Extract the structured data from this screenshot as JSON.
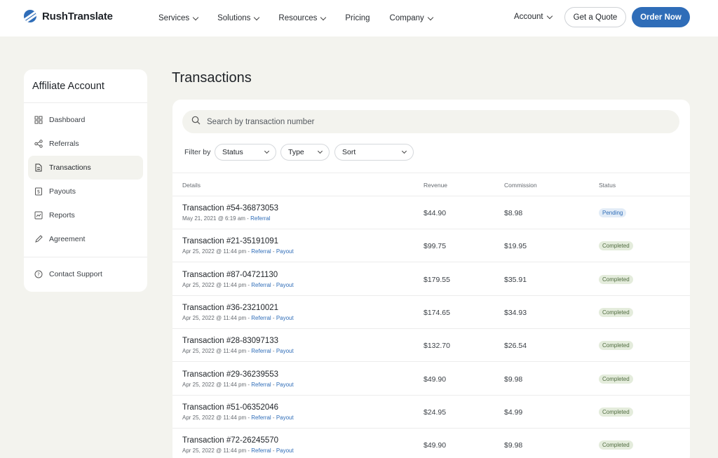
{
  "brand": {
    "name": "RushTranslate"
  },
  "nav": {
    "items": [
      {
        "label": "Services",
        "has_dropdown": true
      },
      {
        "label": "Solutions",
        "has_dropdown": true
      },
      {
        "label": "Resources",
        "has_dropdown": true
      },
      {
        "label": "Pricing",
        "has_dropdown": false
      },
      {
        "label": "Company",
        "has_dropdown": true
      }
    ],
    "account_label": "Account",
    "quote_label": "Get a Quote",
    "order_label": "Order Now"
  },
  "sidebar": {
    "title": "Affiliate Account",
    "items": [
      {
        "label": "Dashboard",
        "icon": "dashboard-icon"
      },
      {
        "label": "Referrals",
        "icon": "share-icon"
      },
      {
        "label": "Transactions",
        "icon": "document-icon",
        "active": true
      },
      {
        "label": "Payouts",
        "icon": "dollar-document-icon"
      },
      {
        "label": "Reports",
        "icon": "chart-icon"
      },
      {
        "label": "Agreement",
        "icon": "pen-icon"
      }
    ],
    "support_label": "Contact Support"
  },
  "main": {
    "title": "Transactions",
    "search": {
      "placeholder": "Search by transaction number",
      "value": ""
    },
    "filter_label": "Filter by",
    "filters": [
      {
        "label": "Status"
      },
      {
        "label": "Type"
      },
      {
        "label": "Sort"
      }
    ],
    "columns": [
      "Details",
      "Revenue",
      "Commission",
      "Status"
    ],
    "rows": [
      {
        "name": "Transaction #54-36873053",
        "date": "May 21, 2021 @ 6:19 am",
        "sep1": " - ",
        "type": "Referral",
        "sep2": "",
        "payout": "",
        "revenue": "$44.90",
        "commission": "$8.98",
        "status": "Pending"
      },
      {
        "name": "Transaction #21-35191091",
        "date": "Apr 25, 2022 @ 11:44 pm",
        "sep1": " - ",
        "type": "Referral",
        "sep2": " - ",
        "payout": "Payout",
        "revenue": "$99.75",
        "commission": "$19.95",
        "status": "Completed"
      },
      {
        "name": "Transaction #87-04721130",
        "date": "Apr 25, 2022 @ 11:44 pm",
        "sep1": " - ",
        "type": "Referral",
        "sep2": " - ",
        "payout": "Payout",
        "revenue": "$179.55",
        "commission": "$35.91",
        "status": "Completed"
      },
      {
        "name": "Transaction #36-23210021",
        "date": "Apr 25, 2022 @ 11:44 pm",
        "sep1": " - ",
        "type": "Referral",
        "sep2": " - ",
        "payout": "Payout",
        "revenue": "$174.65",
        "commission": "$34.93",
        "status": "Completed"
      },
      {
        "name": "Transaction #28-83097133",
        "date": "Apr 25, 2022 @ 11:44 pm",
        "sep1": " - ",
        "type": "Referral",
        "sep2": " - ",
        "payout": "Payout",
        "revenue": "$132.70",
        "commission": "$26.54",
        "status": "Completed"
      },
      {
        "name": "Transaction #29-36239553",
        "date": "Apr 25, 2022 @ 11:44 pm",
        "sep1": " - ",
        "type": "Referral",
        "sep2": " - ",
        "payout": "Payout",
        "revenue": "$49.90",
        "commission": "$9.98",
        "status": "Completed"
      },
      {
        "name": "Transaction #51-06352046",
        "date": "Apr 25, 2022 @ 11:44 pm",
        "sep1": " - ",
        "type": "Referral",
        "sep2": " - ",
        "payout": "Payout",
        "revenue": "$24.95",
        "commission": "$4.99",
        "status": "Completed"
      },
      {
        "name": "Transaction #72-26245570",
        "date": "Apr 25, 2022 @ 11:44 pm",
        "sep1": " - ",
        "type": "Referral",
        "sep2": " - ",
        "payout": "Payout",
        "revenue": "$49.90",
        "commission": "$9.98",
        "status": "Completed"
      }
    ]
  },
  "colors": {
    "accent": "#2f6db8",
    "page_bg": "#f3f3ee",
    "completed_bg": "#e4ecdc",
    "pending_bg": "#e2ecf7"
  }
}
